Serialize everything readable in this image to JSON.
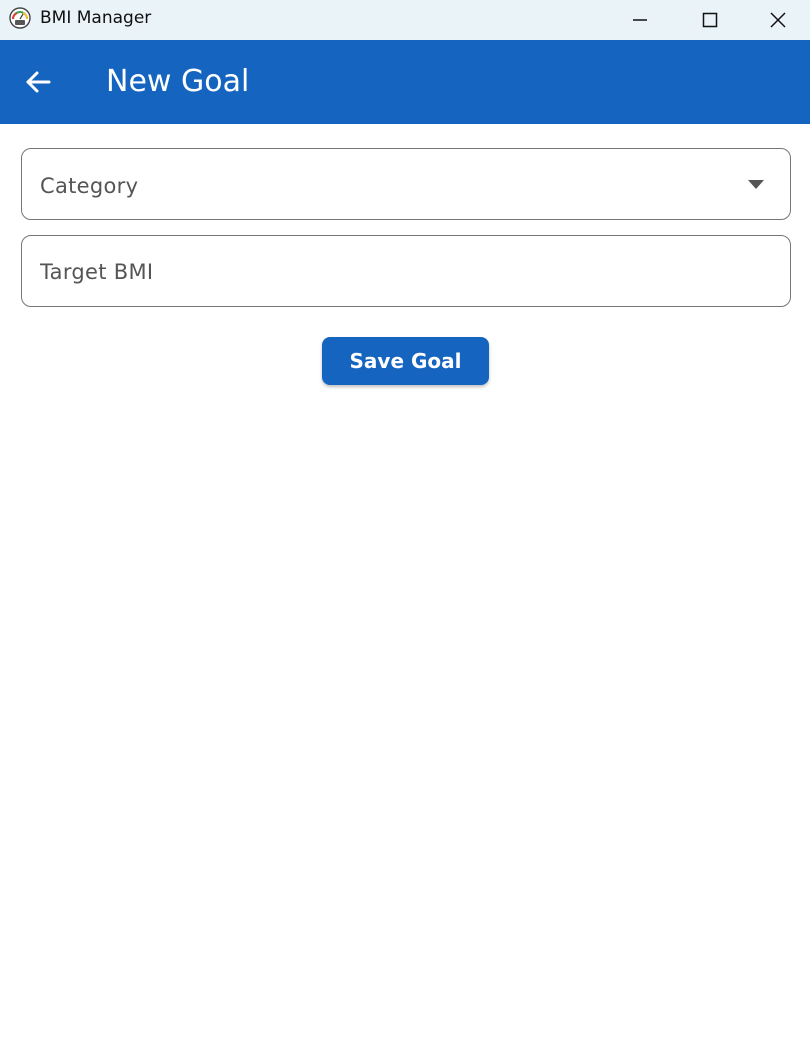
{
  "window": {
    "title": "BMI Manager",
    "app_icon": "bmi-gauge-icon",
    "controls": {
      "minimize_icon": "minimize-icon",
      "maximize_icon": "maximize-icon",
      "close_icon": "close-icon"
    }
  },
  "appbar": {
    "back_icon": "arrow-left-icon",
    "title": "New Goal",
    "background": "#1565c0"
  },
  "form": {
    "category": {
      "label": "Category",
      "selected": "",
      "icon": "dropdown-arrow-icon"
    },
    "target_bmi": {
      "placeholder": "Target BMI",
      "value": ""
    },
    "save_label": "Save Goal"
  },
  "colors": {
    "primary": "#1565c0",
    "titlebar": "#eaf3f8",
    "field_border": "#767676",
    "label_text": "#555555"
  }
}
